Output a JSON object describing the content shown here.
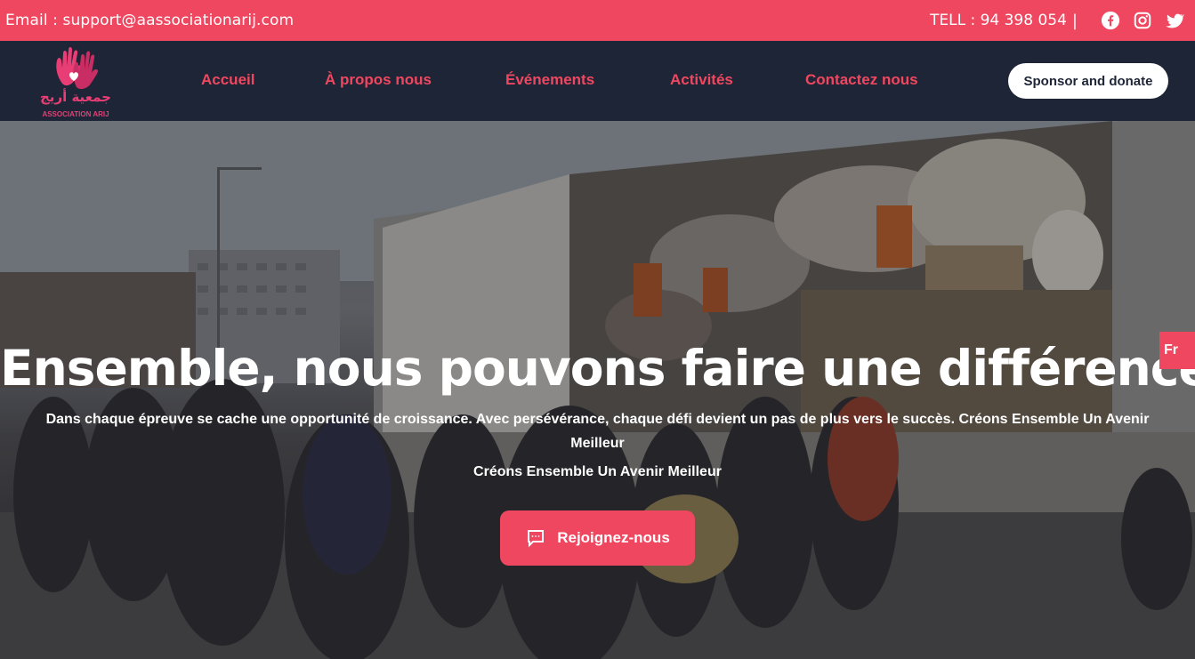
{
  "topbar": {
    "email": "Email : support@aassociationarij.com",
    "tel": "TELL : 94 398 054",
    "separator": "|",
    "social": [
      "facebook-icon",
      "instagram-icon",
      "twitter-icon"
    ]
  },
  "logo": {
    "arabic": "جمعية أريج",
    "latin": "ASSOCIATION ARIJ"
  },
  "nav": {
    "items": [
      {
        "label": "Accueil"
      },
      {
        "label": "À propos nous"
      },
      {
        "label": "Événements"
      },
      {
        "label": "Activités"
      },
      {
        "label": "Contactez nous"
      }
    ],
    "sponsor_label": "Sponsor and donate"
  },
  "hero": {
    "title": "Ensemble, nous pouvons faire une différence",
    "subtitle": "Dans chaque épreuve se cache une opportunité de croissance. Avec persévérance, chaque défi devient un pas de plus vers le succès. Créons Ensemble Un Avenir Meilleur",
    "tagline": "Créons Ensemble Un Avenir Meilleur",
    "cta_label": "Rejoignez-nous",
    "language": "Fr"
  },
  "colors": {
    "accent": "#f04760",
    "nav_bg": "#1e2536",
    "white": "#ffffff"
  }
}
